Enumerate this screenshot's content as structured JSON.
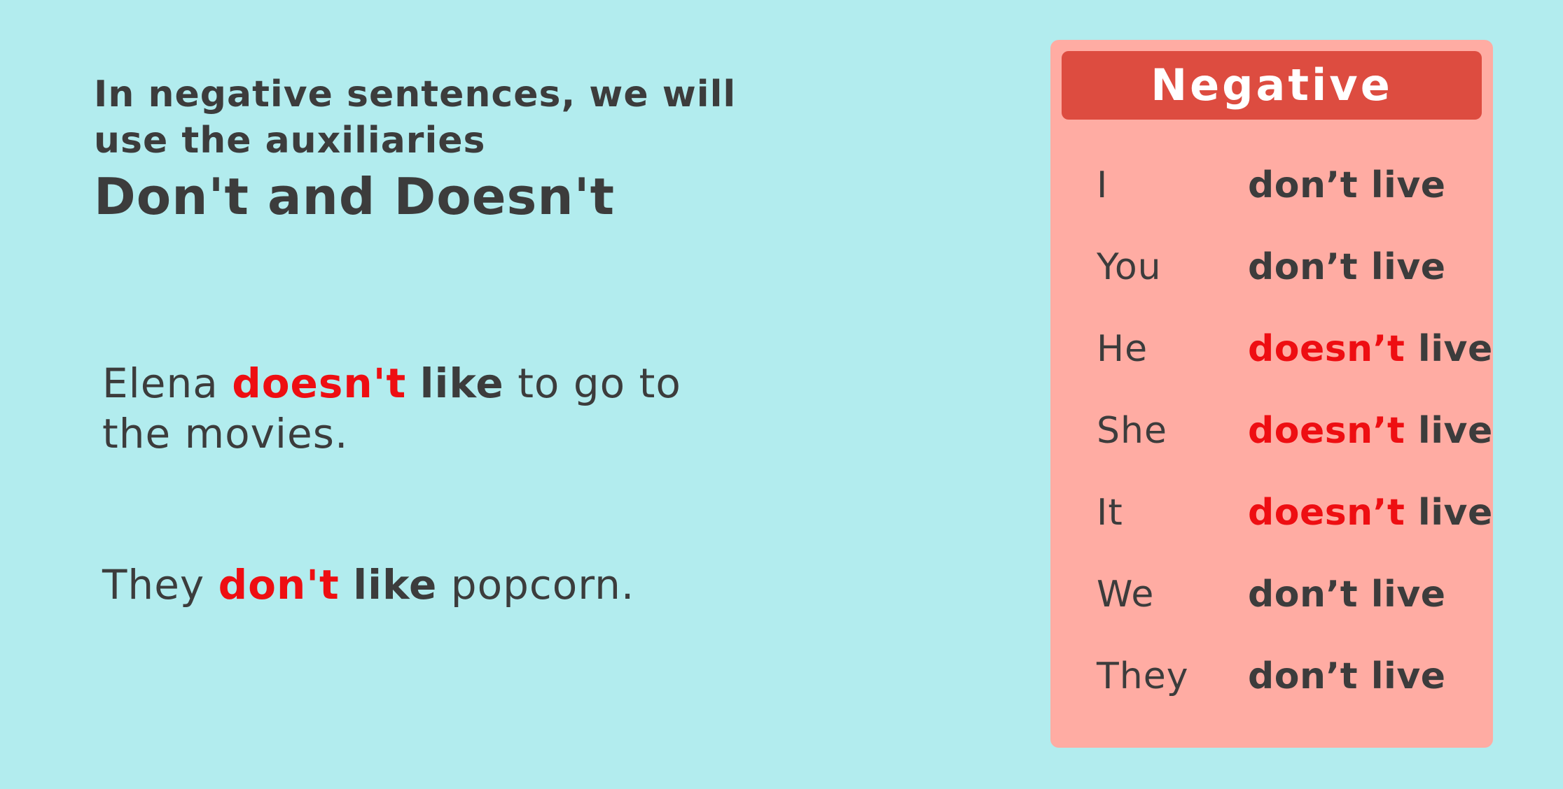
{
  "intro": {
    "line1": "In negative sentences, we will",
    "line2": "use the auxiliaries",
    "title": "Don't and Doesn't"
  },
  "examples": [
    {
      "subject": "Elena",
      "auxiliary": "doesn't",
      "verb": "like",
      "line1_rest": "to go to",
      "line2": "the movies."
    },
    {
      "subject": "They",
      "auxiliary": "don't",
      "verb": "like",
      "rest": "popcorn."
    }
  ],
  "table": {
    "header": "Negative",
    "rows": [
      {
        "pronoun": "I",
        "auxiliary": "don’t",
        "verb": "live",
        "highlight": false
      },
      {
        "pronoun": "You",
        "auxiliary": "don’t",
        "verb": "live",
        "highlight": false
      },
      {
        "pronoun": "He",
        "auxiliary": "doesn’t",
        "verb": "live",
        "highlight": true
      },
      {
        "pronoun": "She",
        "auxiliary": "doesn’t",
        "verb": "live",
        "highlight": true
      },
      {
        "pronoun": "It",
        "auxiliary": "doesn’t",
        "verb": "live",
        "highlight": true
      },
      {
        "pronoun": "We",
        "auxiliary": "don’t",
        "verb": "live",
        "highlight": false
      },
      {
        "pronoun": "They",
        "auxiliary": "don’t",
        "verb": "live",
        "highlight": false
      }
    ]
  },
  "colors": {
    "background": "#b2ecee",
    "text": "#3c3c3c",
    "highlight": "#ee0e12",
    "panel": "#ffaca3",
    "panel_header": "#dd4c40"
  }
}
